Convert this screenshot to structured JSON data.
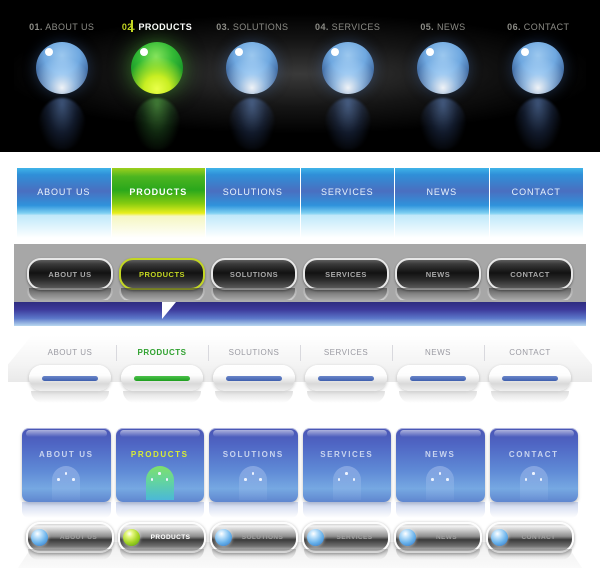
{
  "items": [
    "ABOUT US",
    "PRODUCTS",
    "SOLUTIONS",
    "SERVICES",
    "NEWS",
    "CONTACT"
  ],
  "active_index": 1,
  "colors": {
    "accent_green": "#c3d623",
    "active_green_text": "#2fa12f",
    "blue_tile": "#4a6fc0",
    "dark_bg": "#000000",
    "gray_plate": "#a7a7a7",
    "strip_blue": "#3d3a9b"
  },
  "bar1": {
    "name": "dark-sphere-nav",
    "labels": [
      {
        "num": "01.",
        "text": "ABOUT US"
      },
      {
        "num": "02.",
        "text": "PRODUCTS"
      },
      {
        "num": "03.",
        "text": "SOLUTIONS"
      },
      {
        "num": "04.",
        "text": "SERVICES"
      },
      {
        "num": "05.",
        "text": "NEWS"
      },
      {
        "num": "06.",
        "text": "CONTACT"
      }
    ]
  },
  "bar2": {
    "name": "sky-tile-nav",
    "labels": [
      "ABOUT US",
      "PRODUCTS",
      "SOLUTIONS",
      "SERVICES",
      "NEWS",
      "CONTACT"
    ]
  },
  "bar3": {
    "name": "metal-pill-nav",
    "labels": [
      "ABOUT US",
      "PRODUCTS",
      "SOLUTIONS",
      "SERVICES",
      "NEWS",
      "CONTACT"
    ]
  },
  "bar4": {
    "name": "white-pill-nav",
    "labels": [
      "ABOUT US",
      "PRODUCTS",
      "SOLUTIONS",
      "SERVICES",
      "NEWS",
      "CONTACT"
    ]
  },
  "bar5": {
    "name": "blue-square-nav",
    "labels": [
      "ABOUT US",
      "PRODUCTS",
      "SOLUTIONS",
      "SERVICES",
      "NEWS",
      "CONTACT"
    ],
    "icon": "arch-dots-icon"
  },
  "bar6": {
    "name": "silver-orb-pill-nav",
    "labels": [
      "ABOUT US",
      "PRODUCTS",
      "SOLUTIONS",
      "SERVICES",
      "NEWS",
      "CONTACT"
    ],
    "icon": "glossy-orb-icon"
  }
}
